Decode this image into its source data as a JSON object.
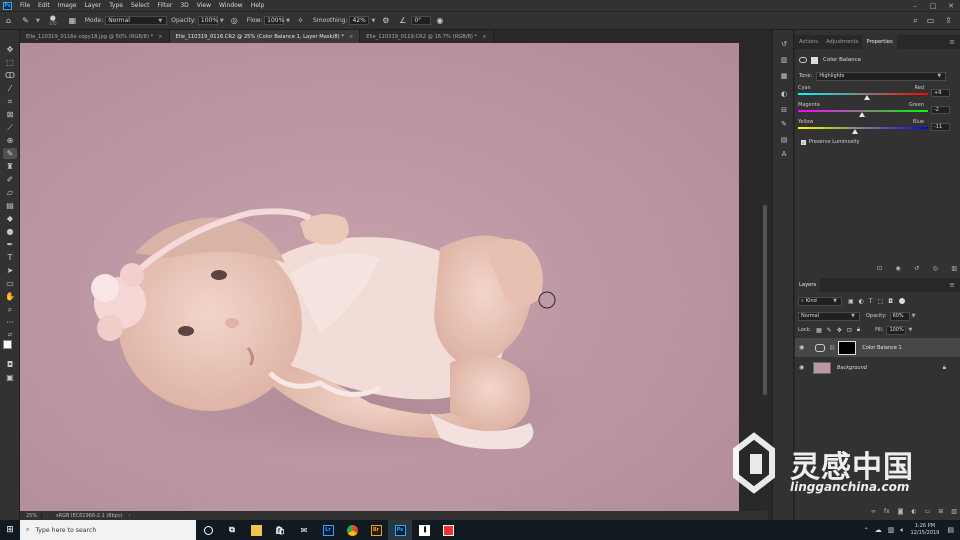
{
  "menu": {
    "items": [
      "File",
      "Edit",
      "Image",
      "Layer",
      "Type",
      "Select",
      "Filter",
      "3D",
      "View",
      "Window",
      "Help"
    ]
  },
  "options_bar": {
    "brush_size": "175",
    "mode_label": "Mode:",
    "mode_value": "Normal",
    "opacity_label": "Opacity:",
    "opacity_value": "100%",
    "flow_label": "Flow:",
    "flow_value": "100%",
    "smoothing_label": "Smoothing:",
    "smoothing_value": "42%",
    "angle_value": "0°"
  },
  "tabs": [
    {
      "label": "Elle_110319_0116e copy18.jpg @ 50% (RGB/8) *",
      "close": "×"
    },
    {
      "label": "Elle_110319_0116.CR2 @ 25% (Color Balance 1, Layer Mask/8) *",
      "close": "×"
    },
    {
      "label": "Elle_110319_0119.CR2 @ 16.7% (RGB/8) *",
      "close": "×"
    }
  ],
  "status": {
    "zoom": "25%",
    "profile": "sRGB IEC61966-2.1 (8bpc)"
  },
  "properties_panel": {
    "tabs": [
      "Actions",
      "Adjustments",
      "Properties"
    ],
    "title": "Color Balance",
    "tone_label": "Tone:",
    "tone_value": "Highlights",
    "sliders": [
      {
        "left": "Cyan",
        "right": "Red",
        "value": "+9",
        "position": 0.53
      },
      {
        "left": "Magenta",
        "right": "Green",
        "value": "-2",
        "position": 0.49
      },
      {
        "left": "Yellow",
        "right": "Blue",
        "value": "-11",
        "position": 0.44
      }
    ],
    "preserve_label": "Preserve Luminosity",
    "preserve_checked": true
  },
  "layers_panel": {
    "tab": "Layers",
    "filter_label": "Kind",
    "blend_mode": "Normal",
    "opacity_label": "Opacity:",
    "opacity_value": "60%",
    "lock_label": "Lock:",
    "fill_label": "Fill:",
    "fill_value": "100%",
    "layers": [
      {
        "name": "Color Balance 1",
        "selected": true
      },
      {
        "name": "Background",
        "selected": false
      }
    ]
  },
  "taskbar": {
    "search_placeholder": "Type here to search",
    "time": "1:26 PM",
    "date": "12/15/2019",
    "apps": [
      "Lr",
      "Br",
      "Ps"
    ]
  },
  "watermark": {
    "chinese": "灵感中国",
    "url": "lingganchina.com"
  },
  "colors": {
    "accent_blue": "#31a8ff",
    "canvas_pink": "#bd97a3",
    "panel_bg": "#323232"
  }
}
